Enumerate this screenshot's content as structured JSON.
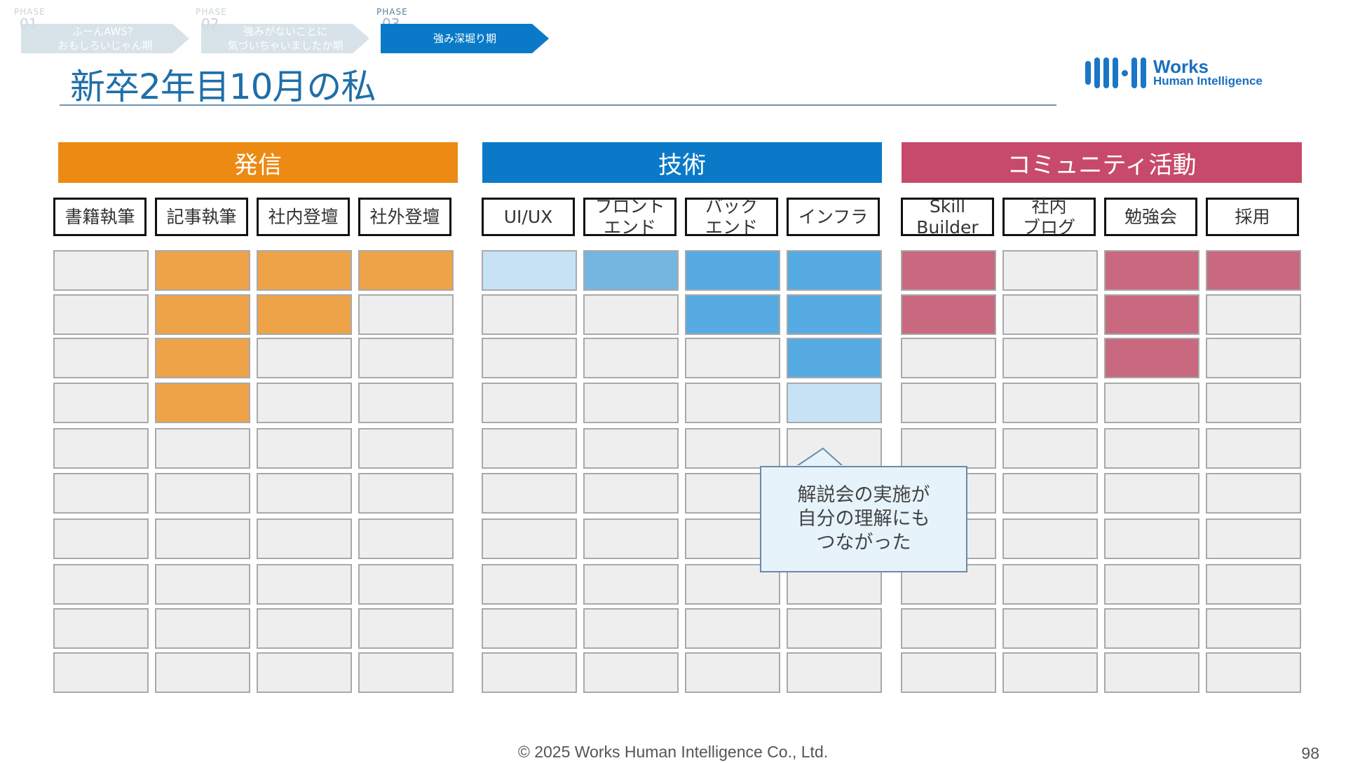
{
  "phases": [
    {
      "label": "PHASE",
      "num": "01",
      "text": "ふーんAWS？\nおもしろいじゃん期",
      "state": "dim"
    },
    {
      "label": "PHASE",
      "num": "02",
      "text": "強みがないことに\n気づいちゃいましたか期",
      "state": "dim"
    },
    {
      "label": "PHASE",
      "num": "03",
      "text": "強み深堀り期",
      "state": "active"
    }
  ],
  "title": "新卒2年目10月の私",
  "logo": {
    "line1": "Works",
    "line2": "Human Intelligence",
    "color": "#1976c8"
  },
  "groups": [
    {
      "name": "発信",
      "color": "#ec8a14",
      "columns": [
        "書籍執筆",
        "記事執筆",
        "社内登壇",
        "社外登壇"
      ]
    },
    {
      "name": "技術",
      "color": "#0a7ac8",
      "columns": [
        "UI/UX",
        "フロント\nエンド",
        "バック\nエンド",
        "インフラ"
      ]
    },
    {
      "name": "コミュニティ活動",
      "color": "#c84a6a",
      "columns": [
        "Skill\nBuilder",
        "社内\nブログ",
        "勉強会",
        "採用"
      ]
    }
  ],
  "grid": {
    "rows": 10,
    "palette": {
      "E": "#eeeeee",
      "O": "#eea348",
      "LB": "#c6e2f4",
      "MB": "#74b6e0",
      "B": "#55abe2",
      "P": "#c86980"
    },
    "columns": [
      [
        "E",
        "E",
        "E",
        "E",
        "E",
        "E",
        "E",
        "E",
        "E",
        "E"
      ],
      [
        "O",
        "O",
        "O",
        "O",
        "E",
        "E",
        "E",
        "E",
        "E",
        "E"
      ],
      [
        "O",
        "O",
        "E",
        "E",
        "E",
        "E",
        "E",
        "E",
        "E",
        "E"
      ],
      [
        "O",
        "E",
        "E",
        "E",
        "E",
        "E",
        "E",
        "E",
        "E",
        "E"
      ],
      [
        "LB",
        "E",
        "E",
        "E",
        "E",
        "E",
        "E",
        "E",
        "E",
        "E"
      ],
      [
        "MB",
        "E",
        "E",
        "E",
        "E",
        "E",
        "E",
        "E",
        "E",
        "E"
      ],
      [
        "B",
        "B",
        "E",
        "E",
        "E",
        "E",
        "E",
        "E",
        "E",
        "E"
      ],
      [
        "B",
        "B",
        "B",
        "LB",
        "E",
        "E",
        "E",
        "E",
        "E",
        "E"
      ],
      [
        "P",
        "P",
        "E",
        "E",
        "E",
        "E",
        "E",
        "E",
        "E",
        "E"
      ],
      [
        "E",
        "E",
        "E",
        "E",
        "E",
        "E",
        "E",
        "E",
        "E",
        "E"
      ],
      [
        "P",
        "P",
        "P",
        "E",
        "E",
        "E",
        "E",
        "E",
        "E",
        "E"
      ],
      [
        "P",
        "E",
        "E",
        "E",
        "E",
        "E",
        "E",
        "E",
        "E",
        "E"
      ]
    ]
  },
  "callout": {
    "text": "解説会の実施が\n自分の理解にも\nつながった"
  },
  "footer": "© 2025 Works Human Intelligence Co., Ltd.",
  "page_number": "98"
}
